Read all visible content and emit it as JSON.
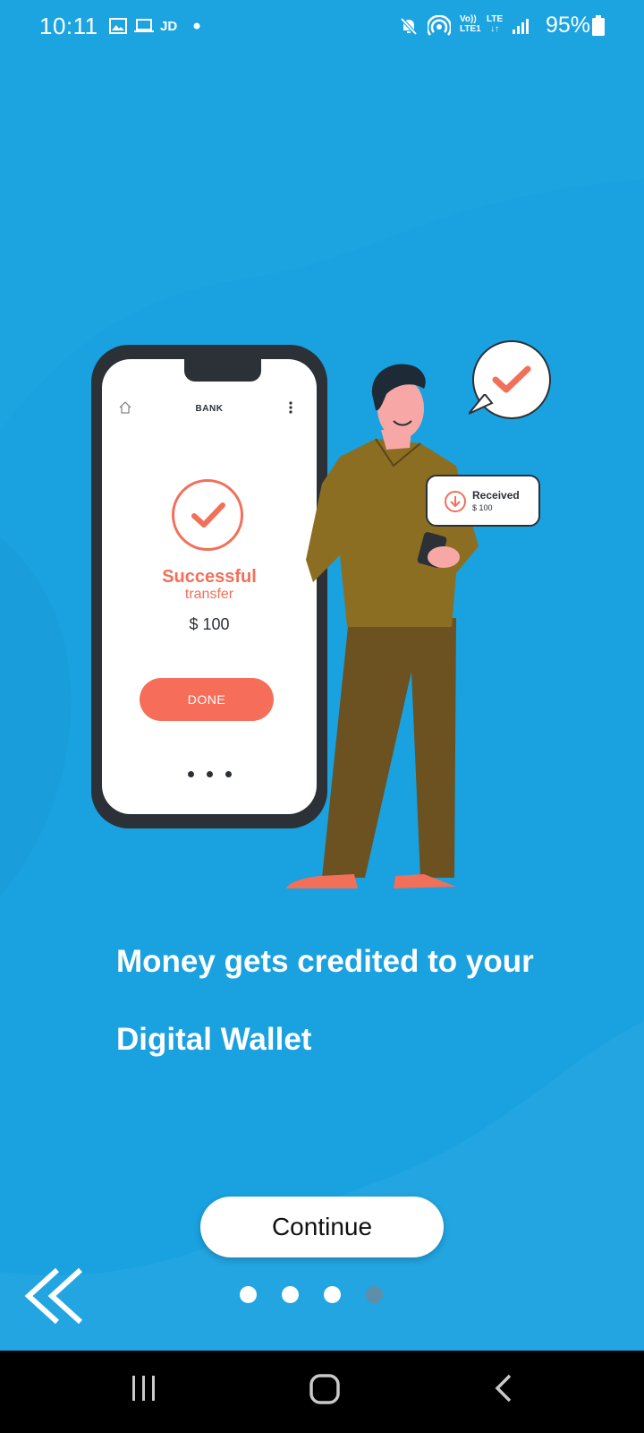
{
  "status_bar": {
    "time": "10:11",
    "carrier_badge": "JD",
    "network_lines": [
      "Vo))",
      "LTE1"
    ],
    "lte_label": "LTE",
    "battery": "95%",
    "icons": [
      "image-icon",
      "laptop-icon",
      "dot-icon",
      "mute-icon",
      "hotspot-icon",
      "signal-icon",
      "battery-icon"
    ]
  },
  "illustration": {
    "phone_screen": {
      "title": "BANK",
      "success_title": "Successful",
      "success_subtitle": "transfer",
      "amount": "$ 100",
      "done_label": "DONE"
    },
    "received_bubble": {
      "label": "Received",
      "amount": "$ 100"
    }
  },
  "content": {
    "heading_line1": "Money gets credited to your",
    "heading_line2": "Digital Wallet"
  },
  "actions": {
    "continue_label": "Continue",
    "back_icon": "double-chevron-left-icon"
  },
  "pager": {
    "total": 4,
    "active_index": 3,
    "colors": {
      "inactive": "#ffffff",
      "active": "#5f8fa8"
    }
  },
  "colors": {
    "background": "#1aa1df",
    "accent": "#f66e5a",
    "phone_frame": "#2b3137"
  },
  "navigation_bar": {
    "icons": [
      "recent-apps-icon",
      "home-icon",
      "back-icon"
    ]
  }
}
